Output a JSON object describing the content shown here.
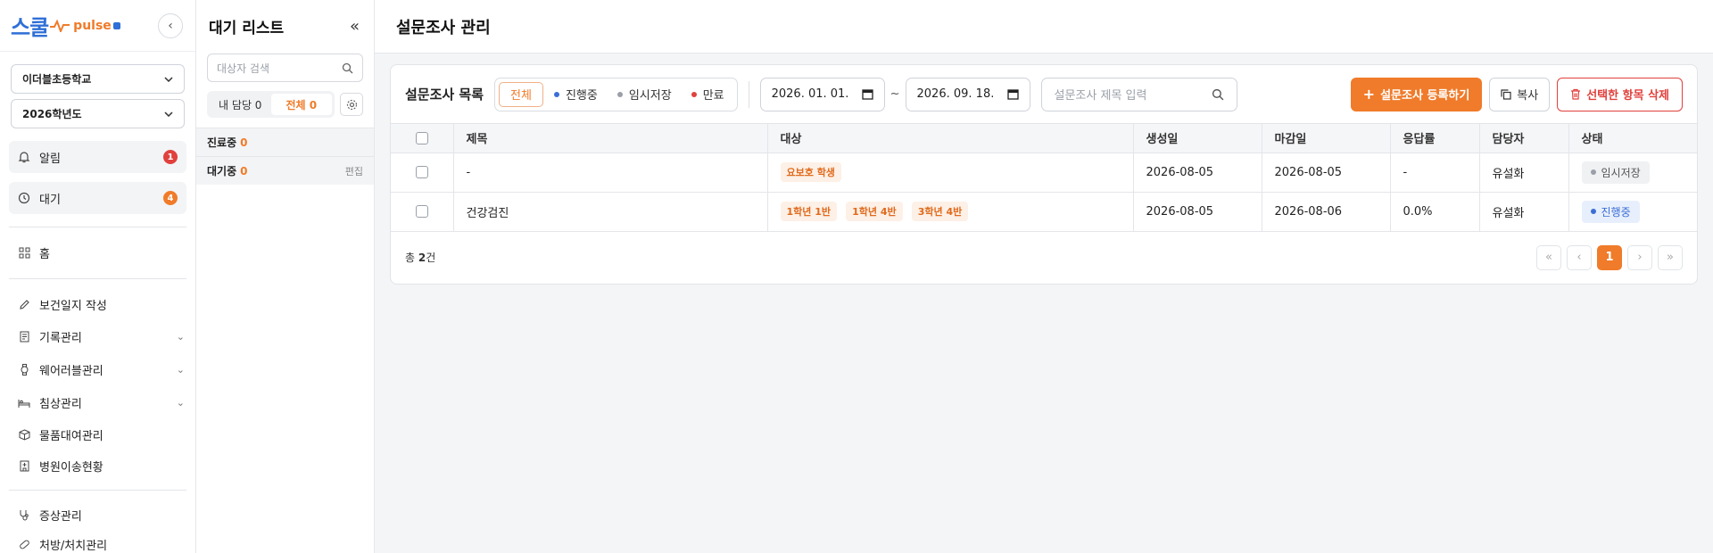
{
  "sidebar": {
    "logo_ko": "스쿨",
    "logo_pulse": "pulse",
    "school": "이더블초등학교",
    "year": "2026학년도",
    "chips": [
      {
        "label": "알림",
        "count": "1"
      },
      {
        "label": "대기",
        "count": "4"
      }
    ],
    "items": [
      {
        "label": "홈"
      },
      {
        "label": "보건일지 작성"
      },
      {
        "label": "기록관리"
      },
      {
        "label": "웨어러블관리"
      },
      {
        "label": "침상관리"
      },
      {
        "label": "물품대여관리"
      },
      {
        "label": "병원이송현황"
      },
      {
        "label": "증상관리"
      },
      {
        "label": "처방/처치관리"
      }
    ]
  },
  "waiting": {
    "title": "대기 리스트",
    "search_placeholder": "대상자 검색",
    "toggle": {
      "mine": "내 담당 0",
      "all": "전체 0"
    },
    "sections": [
      {
        "label": "진료중",
        "count": "0",
        "action": ""
      },
      {
        "label": "대기중",
        "count": "0",
        "action": "편집"
      }
    ]
  },
  "main": {
    "title": "설문조사 관리",
    "list_title": "설문조사 목록",
    "filters": [
      {
        "label": "전체",
        "dot": ""
      },
      {
        "label": "진행중",
        "dot": "#3b6ed6"
      },
      {
        "label": "임시저장",
        "dot": "#9aa0a8"
      },
      {
        "label": "만료",
        "dot": "#e0413d"
      }
    ],
    "date_from": "2026. 01. 01.",
    "date_to": "2026. 09. 18.",
    "tilde": "~",
    "search_placeholder": "설문조사 제목 입력",
    "buttons": {
      "register": "설문조사 등록하기",
      "copy": "복사",
      "delete": "선택한 항목 삭제"
    },
    "columns": [
      "제목",
      "대상",
      "생성일",
      "마감일",
      "응답률",
      "담당자",
      "상태"
    ],
    "rows": [
      {
        "title": "-",
        "targets": [
          "요보호 학생"
        ],
        "created": "2026-08-05",
        "due": "2026-08-05",
        "rate": "-",
        "owner": "유설화",
        "status": "임시저장",
        "status_color": "gray"
      },
      {
        "title": "건강검진",
        "targets": [
          "1학년 1반",
          "1학년 4반",
          "3학년 4반"
        ],
        "created": "2026-08-05",
        "due": "2026-08-06",
        "rate": "0.0%",
        "owner": "유설화",
        "status": "진행중",
        "status_color": "blue"
      }
    ],
    "total_prefix": "총 ",
    "total_count": "2",
    "total_suffix": "건",
    "pager": {
      "first": "«",
      "prev": "‹",
      "current": "1",
      "next": "›",
      "last": "»"
    }
  },
  "colors": {
    "accent": "#f07b2a",
    "danger": "#e0413d",
    "brand": "#2f6fd6"
  }
}
